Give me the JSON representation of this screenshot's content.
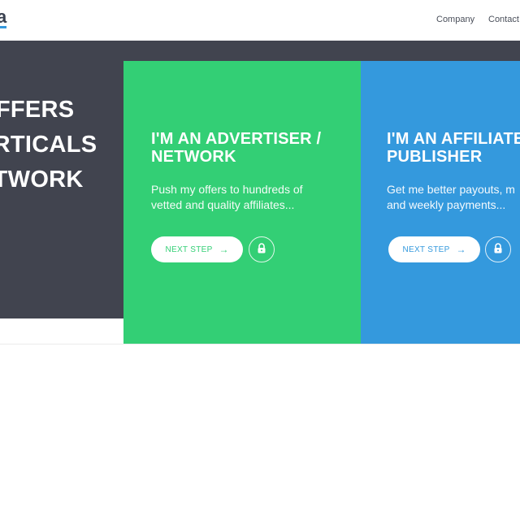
{
  "header": {
    "logo_fragment": "a",
    "nav": [
      {
        "label": "Company"
      },
      {
        "label": "Contact"
      }
    ]
  },
  "hero": {
    "lines": [
      "OFFERS",
      "ERTICALS",
      "ETWORK"
    ]
  },
  "cards": [
    {
      "title": "I'M AN ADVERTISER /\nNETWORK",
      "description": "Push my offers to hundreds of\nvetted and quality affiliates...",
      "button_label": "NEXT STEP",
      "color": "#33cf75"
    },
    {
      "title": "I'M AN AFFILIATE\nPUBLISHER",
      "description": "Get me better payouts, m\nand weekly payments...",
      "button_label": "NEXT STEP",
      "color": "#3499dd"
    }
  ],
  "colors": {
    "hero_background": "#41444f",
    "accent": "#3598dc"
  },
  "icons": [
    "arrow-right-icon",
    "lock-icon"
  ]
}
